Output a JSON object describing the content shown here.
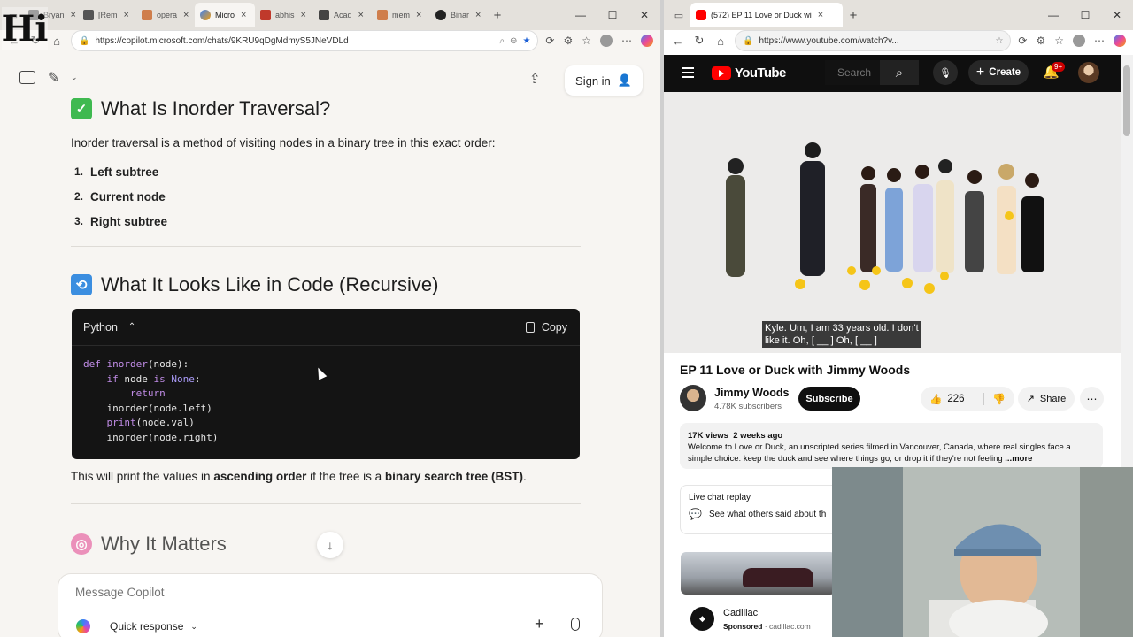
{
  "left_browser": {
    "tabs": [
      {
        "label": "Bryan",
        "color": "#6b6b6b"
      },
      {
        "label": "[Rem",
        "color": "#555"
      },
      {
        "label": "opera",
        "color": "#cf7e4c"
      },
      {
        "label": "Micro",
        "color": "#3b82f6"
      },
      {
        "label": "abhis",
        "color": "#c0392b"
      },
      {
        "label": "Acad",
        "color": "#444"
      },
      {
        "label": "mem",
        "color": "#cf7e4c"
      },
      {
        "label": "Binar",
        "color": "#222"
      }
    ],
    "url": "https://copilot.microsoft.com/chats/9KRU9qDgMdmyS5JNeVDLd"
  },
  "copilot": {
    "sign_in": "Sign in",
    "section1": {
      "title": "What Is Inorder Traversal?",
      "intro": "Inorder traversal is a method of visiting nodes in a binary tree in this exact order:",
      "steps": [
        {
          "num": "1.",
          "text": "Left subtree"
        },
        {
          "num": "2.",
          "text": "Current node"
        },
        {
          "num": "3.",
          "text": "Right subtree"
        }
      ]
    },
    "section2": {
      "title": "What It Looks Like in Code (Recursive)",
      "code_language": "Python",
      "copy_label": "Copy",
      "after_text_1": "This will print the values in ",
      "after_bold_1": "ascending order",
      "after_text_2": " if the tree is a ",
      "after_bold_2": "binary search tree (BST)",
      "after_text_3": "."
    },
    "section3": {
      "title": "Why It Matters"
    },
    "message_placeholder": "Message Copilot",
    "quick_response": "Quick response"
  },
  "right_browser": {
    "tab_label": "(572) EP 11 Love or Duck wi",
    "url": "https://www.youtube.com/watch?v..."
  },
  "youtube": {
    "logo": "YouTube",
    "search_placeholder": "Search",
    "create": "Create",
    "notif_badge": "9+",
    "caption_line1": "Kyle. Um, I am 33 years old. I don't",
    "caption_line2": "like it. Oh, [ __ ] Oh, [ __ ]",
    "video_title": "EP 11 Love or Duck with Jimmy Woods",
    "channel": "Jimmy Woods",
    "subscribers": "4.78K subscribers",
    "subscribe": "Subscribe",
    "likes": "226",
    "share": "Share",
    "views": "17K views",
    "age": "2 weeks ago",
    "description": "Welcome to Love or Duck, an unscripted series filmed in Vancouver, Canada, where real singles face a simple choice: keep the duck and see where things go, or drop it if they're not feeling",
    "more": "...more",
    "live_chat_title": "Live chat replay",
    "live_chat_text": "See what others said about th",
    "ad_name": "Cadillac",
    "ad_sponsored": "Sponsored",
    "ad_domain": "cadillac.com"
  }
}
